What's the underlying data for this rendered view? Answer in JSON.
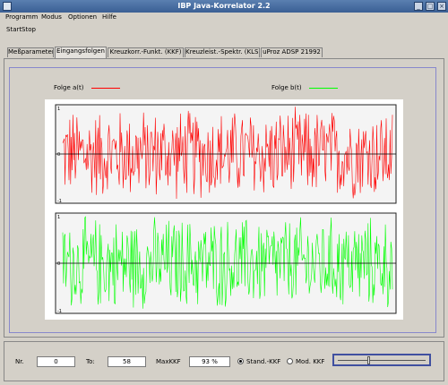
{
  "window": {
    "title": "IBP Java-Korrelator 2.2"
  },
  "menu": {
    "items": [
      "Programm",
      "Modus",
      "Optionen",
      "Hilfe"
    ]
  },
  "toolbar": {
    "start": "Start",
    "stop": "Stop"
  },
  "tabs": [
    {
      "label": "Meßparameter",
      "active": false
    },
    {
      "label": "Eingangsfolgen",
      "active": true
    },
    {
      "label": "Kreuzkorr.-Funkt. (KKF)",
      "active": false
    },
    {
      "label": "Kreuzleist.-Spektr. (KLS)",
      "active": false
    },
    {
      "label": "uProz ADSP 21992",
      "active": false
    }
  ],
  "legend": {
    "a": {
      "label": "Folge a(t)",
      "color": "#ff0000"
    },
    "b": {
      "label": "Folge b(t)",
      "color": "#00ff00"
    }
  },
  "chart_data": [
    {
      "type": "line",
      "series": [
        {
          "name": "Folge a(t)",
          "color": "#ff0000",
          "values": []
        }
      ],
      "y_ticks": [
        "1",
        "0",
        "-1"
      ],
      "ylim": [
        -1,
        1
      ],
      "grid": false
    },
    {
      "type": "line",
      "series": [
        {
          "name": "Folge b(t)",
          "color": "#00ff00",
          "values": []
        }
      ],
      "y_ticks": [
        "1",
        "0",
        "-1"
      ],
      "ylim": [
        -1,
        1
      ],
      "grid": false
    }
  ],
  "bottom": {
    "nr_label": "Nr.",
    "nr_value": "0",
    "to_label": "To:",
    "to_value": "58",
    "maxkkf_label": "MaxKKF",
    "maxkkf_value": "93 %",
    "radio_stand": "Stand.-KKF",
    "radio_mod": "Mod. KKF",
    "slider_value": 0.35
  }
}
